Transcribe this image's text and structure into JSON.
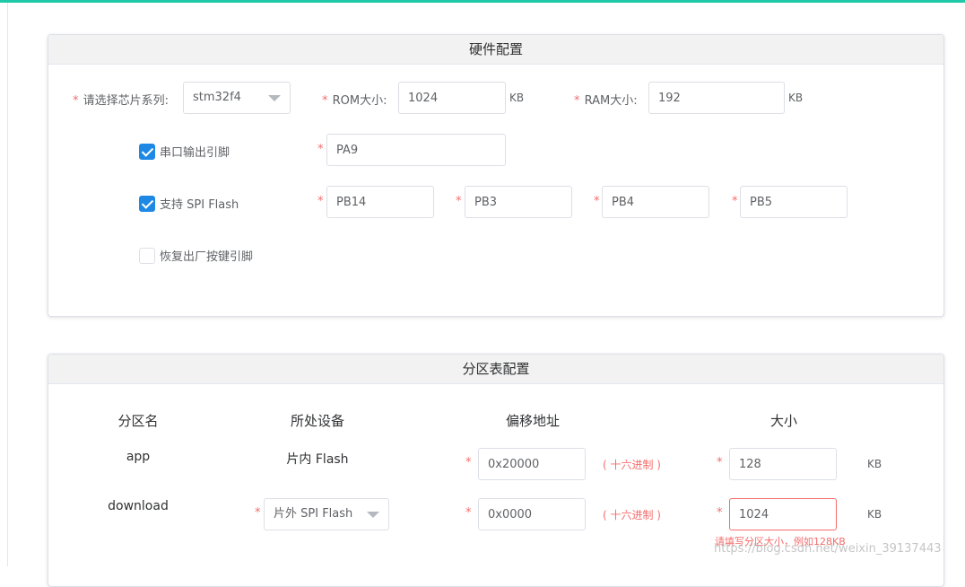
{
  "hardware": {
    "title": "硬件配置",
    "chip_label": "请选择芯片系列:",
    "chip_value": "stm32f4",
    "rom_label": "ROM大小:",
    "rom_value": "1024",
    "rom_unit": "KB",
    "ram_label": "RAM大小:",
    "ram_value": "192",
    "ram_unit": "KB",
    "uart": {
      "label": "串口输出引脚",
      "checked": true,
      "pin": "PA9"
    },
    "spi": {
      "label": "支持 SPI Flash",
      "checked": true,
      "pins": [
        "PB14",
        "PB3",
        "PB4",
        "PB5"
      ]
    },
    "reset": {
      "label": "恢复出厂按键引脚",
      "checked": false
    }
  },
  "partition": {
    "title": "分区表配置",
    "headers": [
      "分区名",
      "所处设备",
      "偏移地址",
      "大小"
    ],
    "hex_hint": "( 十六进制 )",
    "rows": [
      {
        "name": "app",
        "device": "片内 Flash",
        "offset": "0x20000",
        "size": "128",
        "unit": "KB"
      },
      {
        "name": "download",
        "device": "片外 SPI Flash",
        "offset": "0x0000",
        "size": "1024",
        "unit": "KB"
      }
    ],
    "error_message": "请填写分区大小，例如128KB"
  },
  "watermark": "https://blog.csdn.net/weixin_39137443"
}
